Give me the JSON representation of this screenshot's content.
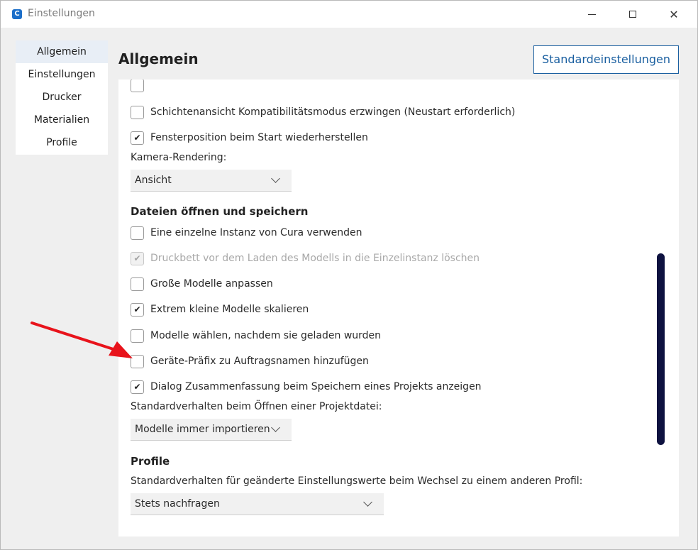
{
  "window": {
    "title": "Einstellungen",
    "icon_letter": "C"
  },
  "sidebar": {
    "items": [
      {
        "label": "Allgemein",
        "active": true
      },
      {
        "label": "Einstellungen"
      },
      {
        "label": "Drucker"
      },
      {
        "label": "Materialien"
      },
      {
        "label": "Profile"
      }
    ]
  },
  "header": {
    "title": "Allgemein",
    "defaults_button": "Standardeinstellungen"
  },
  "settings": {
    "cut_row_label": "",
    "compat_mode": {
      "label": "Schichtenansicht Kompatibilitätsmodus erzwingen (Neustart erforderlich)",
      "checked": false
    },
    "restore_window": {
      "label": "Fensterposition beim Start wiederherstellen",
      "checked": true
    },
    "camera_label": "Kamera-Rendering:",
    "camera_value": "Ansicht",
    "files_section": "Dateien öffnen und speichern",
    "single_instance": {
      "label": "Eine einzelne Instanz von Cura verwenden",
      "checked": false
    },
    "clear_buildplate": {
      "label": "Druckbett vor dem Laden des Modells in die Einzelinstanz löschen",
      "checked": true,
      "disabled": true
    },
    "scale_large": {
      "label": "Große Modelle anpassen",
      "checked": false
    },
    "scale_small": {
      "label": "Extrem kleine Modelle skalieren",
      "checked": true
    },
    "select_loaded": {
      "label": "Modelle wählen, nachdem sie geladen wurden",
      "checked": false
    },
    "prefix_jobname": {
      "label": "Geräte-Präfix zu Auftragsnamen hinzufügen",
      "checked": false
    },
    "summary_dialog": {
      "label": "Dialog Zusammenfassung beim Speichern eines Projekts anzeigen",
      "checked": true
    },
    "project_open_label": "Standardverhalten beim Öffnen einer Projektdatei:",
    "project_open_value": "Modelle immer importieren",
    "profiles_section": "Profile",
    "profile_change_label": "Standardverhalten für geänderte Einstellungswerte beim Wechsel zu einem anderen Profil:",
    "profile_change_value": "Stets nachfragen"
  },
  "icons": {
    "check": "✔",
    "close": "✕"
  },
  "colors": {
    "accent": "#1a5fa0",
    "scrollbar": "#0e1240",
    "annotation_arrow": "#e8131b"
  }
}
